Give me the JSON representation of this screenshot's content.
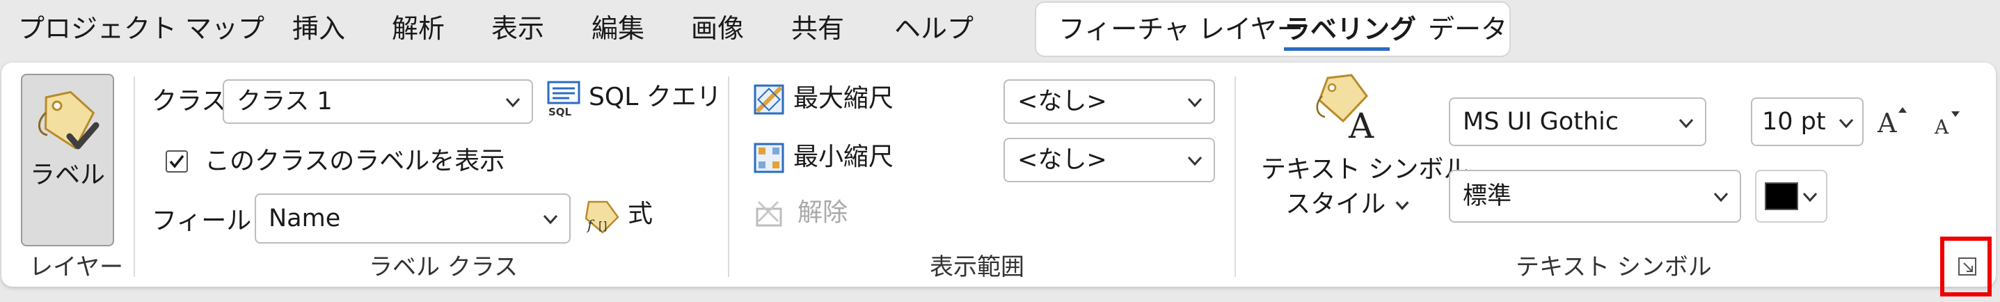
{
  "menu": {
    "items": [
      "プロジェクト",
      "マップ",
      "挿入",
      "解析",
      "表示",
      "編集",
      "画像",
      "共有",
      "ヘルプ"
    ]
  },
  "contextual_tabs": {
    "items": [
      "フィーチャ レイヤー",
      "ラベリング",
      "データ"
    ],
    "active": "ラベリング"
  },
  "ribbon": {
    "layer_group": {
      "label_button": "ラベル",
      "group_label": "レイヤー"
    },
    "label_class_group": {
      "class_label": "クラス",
      "class_value": "クラス 1",
      "sql_query": "SQL クエリ",
      "show_labels_checkbox": {
        "label": "このクラスのラベルを表示",
        "checked": true
      },
      "field_label": "フィールド",
      "field_value": "Name",
      "expression": "式",
      "group_label": "ラベル クラス"
    },
    "visibility_range_group": {
      "max_scale_label": "最大縮尺",
      "max_scale_value": "<なし>",
      "min_scale_label": "最小縮尺",
      "min_scale_value": "<なし>",
      "clear_label": "解除",
      "group_label": "表示範囲"
    },
    "text_symbol_group": {
      "style_button_line1": "テキスト シンボル",
      "style_button_line2": "スタイル",
      "font_value": "MS UI Gothic",
      "size_value": "10 pt",
      "style_value": "標準",
      "font_color": "#000000",
      "group_label": "テキスト シンボル"
    }
  },
  "highlight_color": "#ee0000",
  "accent_color": "#2b6cc0"
}
